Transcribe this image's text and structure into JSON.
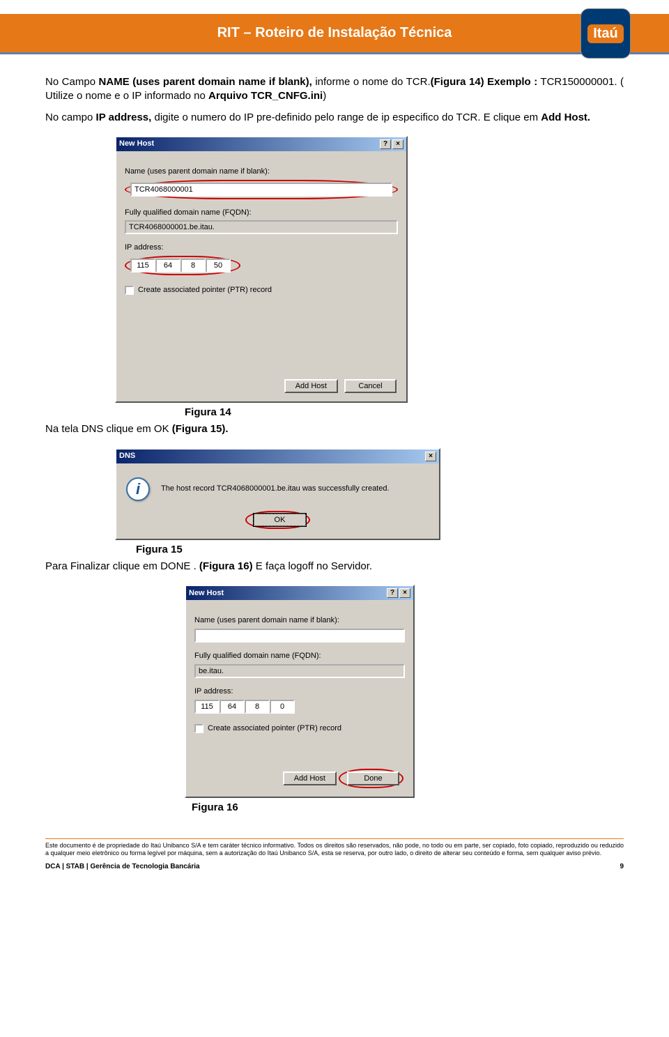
{
  "header": {
    "title": "RIT – Roteiro de Instalação Técnica",
    "logo": "Itaú"
  },
  "para1": {
    "t1": "No Campo ",
    "b1": "NAME (uses parent domain name if blank), ",
    "t2": "informe o nome do TCR.",
    "b2": "(Figura 14) Exemplo :",
    "t3": " TCR150000001. ( Utilize o nome e o IP  informado no ",
    "b3": "Arquivo TCR_CNFG.ini",
    "t4": ")"
  },
  "para2": {
    "t1": "No campo",
    "b1": " IP address, ",
    "t2": "digite o numero do IP pre-definido pelo range de ip especifico do TCR. E clique em ",
    "b2": "Add Host."
  },
  "dlg14": {
    "title": "New Host",
    "lbl_name": "Name (uses parent domain name if blank):",
    "val_name": "TCR4068000001",
    "lbl_fqdn": "Fully qualified domain name (FQDN):",
    "val_fqdn": "TCR4068000001.be.itau.",
    "lbl_ip": "IP address:",
    "ip": [
      "115",
      "64",
      "8",
      "50"
    ],
    "chk": "Create associated pointer (PTR) record",
    "btn_add": "Add Host",
    "btn_cancel": "Cancel"
  },
  "fig14": "Figura 14",
  "para3": {
    "t1": "Na tela DNS clique em OK ",
    "b1": "(Figura 15)."
  },
  "dlg15": {
    "title": "DNS",
    "msg": "The host record TCR4068000001.be.itau was successfully created.",
    "btn_ok": "OK"
  },
  "fig15": "Figura 15",
  "para4": {
    "t1": "Para Finalizar  clique em DONE . ",
    "b1": "(Figura 16) ",
    "t2": "E faça logoff no Servidor."
  },
  "dlg16": {
    "title": "New Host",
    "lbl_name": "Name (uses parent domain name if blank):",
    "val_name": "",
    "lbl_fqdn": "Fully qualified domain name (FQDN):",
    "val_fqdn": "be.itau.",
    "lbl_ip": "IP address:",
    "ip": [
      "115",
      "64",
      "8",
      "0"
    ],
    "chk": "Create associated pointer (PTR) record",
    "btn_add": "Add Host",
    "btn_done": "Done"
  },
  "fig16": "Figura 16",
  "footer": {
    "disclaimer": "Este documento é de propriedade do Itaú Unibanco S/A e tem caráter técnico informativo. Todos os direitos são reservados, não pode, no todo ou em parte, ser copiado, foto copiado, reproduzido ou reduzido a qualquer meio eletrônico ou forma legível por máquina, sem a autorização do Itaú Unibanco S/A, esta se reserva, por outro lado, o direito de alterar seu conteúdo e forma, sem qualquer aviso prévio.",
    "left": "DCA | STAB | Gerência de Tecnologia Bancária",
    "page": "9"
  }
}
